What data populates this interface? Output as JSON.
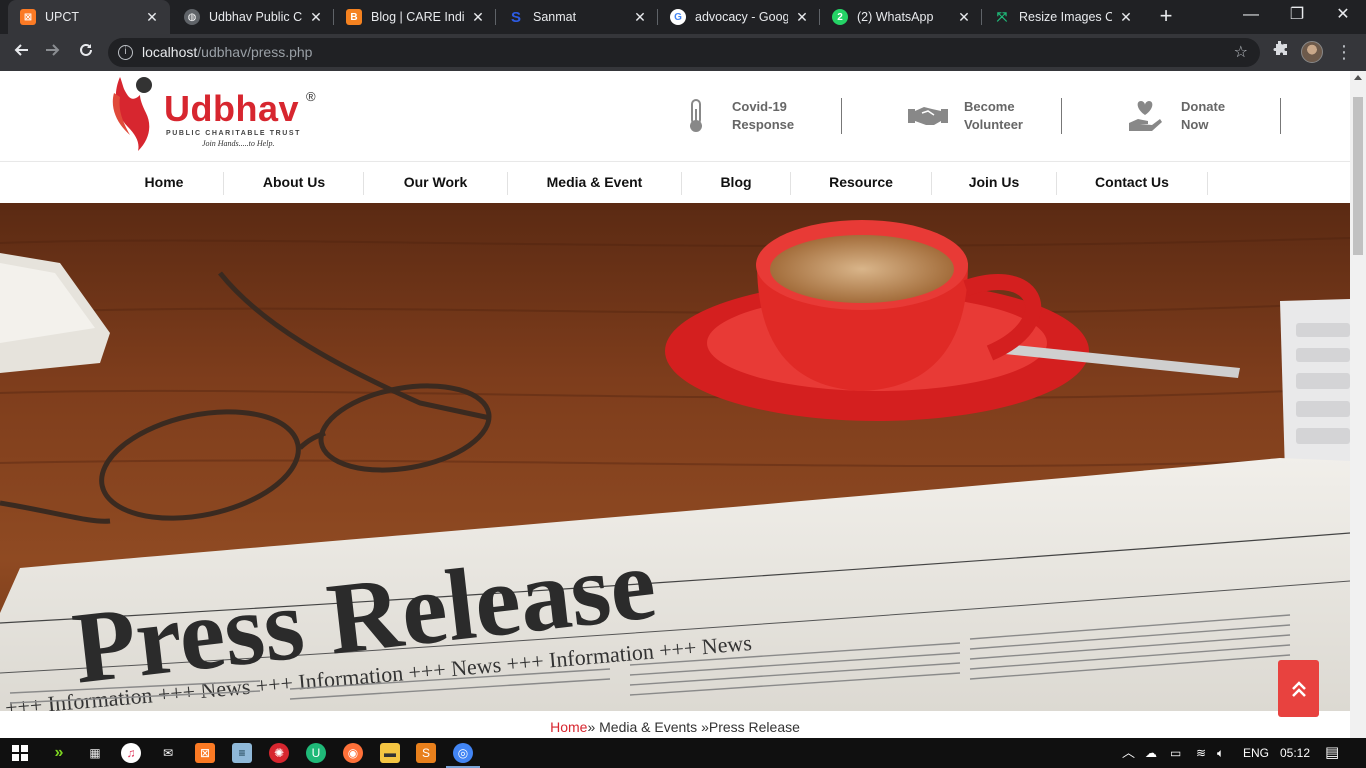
{
  "browser": {
    "tabs": [
      {
        "title": "UPCT",
        "favicon": "xampp-icon",
        "color": "#fb7a24",
        "active": true
      },
      {
        "title": "Udbhav Public Cha",
        "favicon": "globe-icon",
        "color": "#9aa0a6",
        "active": false
      },
      {
        "title": "Blog | CARE India",
        "favicon": "blogger-icon",
        "color": "#f58220",
        "active": false
      },
      {
        "title": "Sanmat",
        "favicon": "s-icon",
        "color": "#2d5be3",
        "active": false
      },
      {
        "title": "advocacy - Google",
        "favicon": "google-icon",
        "color": "#ffffff",
        "active": false
      },
      {
        "title": "(2) WhatsApp",
        "favicon": "whatsapp-icon",
        "color": "#25d366",
        "active": false
      },
      {
        "title": "Resize Images Onl",
        "favicon": "resize-icon",
        "color": "#1fb978",
        "active": false
      }
    ],
    "url_host": "localhost",
    "url_path": "/udbhav/press.php"
  },
  "site": {
    "logo": {
      "word": "Udbhav",
      "registered": "®",
      "subtitle": "PUBLIC CHARITABLE TRUST",
      "tagline": "Join Hands.....to Help."
    },
    "header_links": [
      {
        "label": "Covid-19\nResponse",
        "icon": "thermometer-icon"
      },
      {
        "label": "Become\nVolunteer",
        "icon": "handshake-icon"
      },
      {
        "label": "Donate\nNow",
        "icon": "heart-hand-icon"
      }
    ],
    "nav": [
      "Home",
      "About Us",
      "Our Work",
      "Media & Event",
      "Blog",
      "Resource",
      "Join Us",
      "Contact Us"
    ],
    "hero": {
      "headline": "Press Release",
      "ticker": "+++ Information +++ News +++ Information +++ News +++ Information +++ News"
    },
    "breadcrumb": {
      "home": "Home",
      "middle": "» Media & Events »",
      "current": "Press Release"
    }
  },
  "taskbar": {
    "language": "ENG",
    "time": "05:12",
    "colors": {
      "accent": "#d7262f",
      "scrolltop": "#e8423f"
    }
  }
}
